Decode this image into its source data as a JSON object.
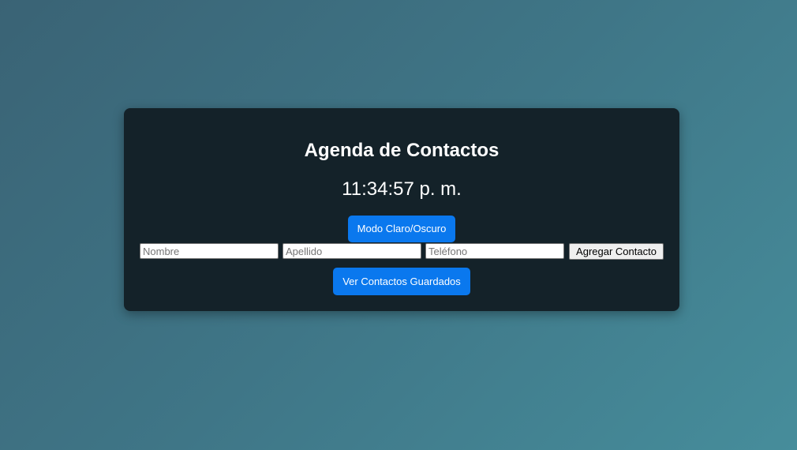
{
  "app": {
    "title": "Agenda de Contactos",
    "clock": "11:34:57 p. m."
  },
  "controls": {
    "theme_toggle_label": "Modo Claro/Oscuro",
    "view_contacts_label": "Ver Contactos Guardados"
  },
  "form": {
    "nombre": {
      "placeholder": "Nombre",
      "value": ""
    },
    "apellido": {
      "placeholder": "Apellido",
      "value": ""
    },
    "telefono": {
      "placeholder": "Teléfono",
      "value": ""
    },
    "add_label": "Agregar Contacto"
  },
  "colors": {
    "card_background": "#142229",
    "primary_button": "#0a78ee",
    "page_gradient_start": "#3a6375",
    "page_gradient_end": "#468d9b"
  }
}
